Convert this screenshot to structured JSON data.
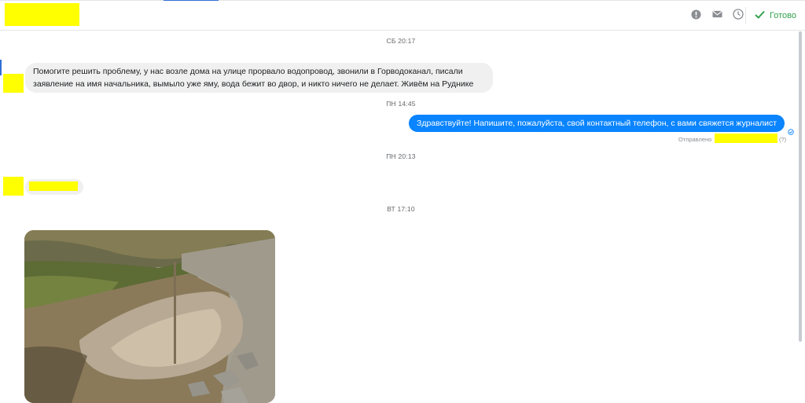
{
  "header": {
    "icons": [
      "exclamation-circle-icon",
      "envelope-icon",
      "clock-icon"
    ],
    "done_label": "Готово",
    "done_color": "#31a24c"
  },
  "messages": [
    {
      "timestamp": "СБ 20:17",
      "direction": "incoming",
      "text": "Помогите решить проблему,  у нас возле дома на улице прорвало водопровод,  звонили в Горводоканал, писали заявление на имя начальника, вымыло уже яму, вода бежит во двор, и никто ничего не делает. Живём на Руднике"
    },
    {
      "timestamp": "ПН 14:45",
      "direction": "outgoing",
      "text": "Здравствуйте! Напишите, пожалуйста, свой контактный телефон, с вами свяжется журналист",
      "status_label": "Отправлено",
      "status_suffix": "(?)"
    },
    {
      "timestamp": "ПН 20:13",
      "direction": "incoming",
      "text": ""
    },
    {
      "timestamp": "ВТ 17:10",
      "direction": "incoming",
      "attachment": "photo"
    }
  ],
  "colors": {
    "outgoing_bubble": "#0a84ff",
    "incoming_bubble": "#f0f0f0",
    "accent": "#2f6fd6",
    "redaction": "#ffff00"
  }
}
